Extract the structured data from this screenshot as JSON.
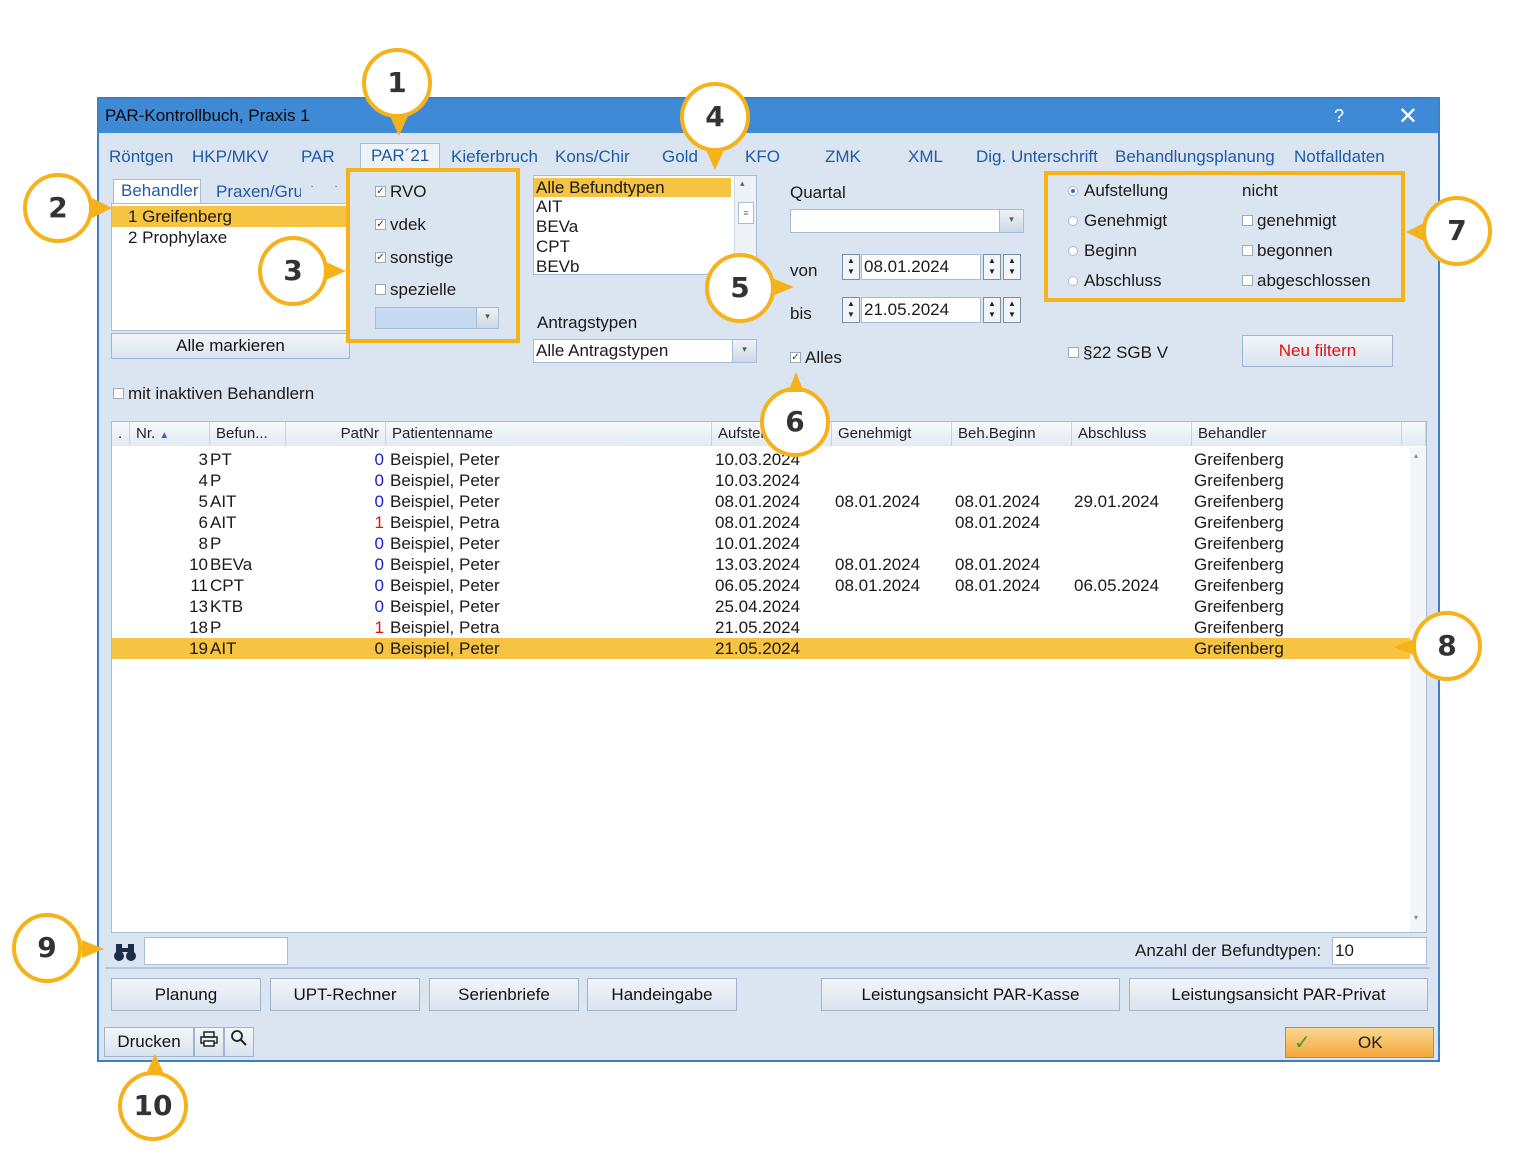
{
  "window": {
    "title": "PAR-Kontrollbuch, Praxis 1",
    "help": "?",
    "close": "✕"
  },
  "tabs": [
    "Röntgen",
    "HKP/MKV",
    "PAR",
    "PAR´21",
    "Kieferbruch",
    "Kons/Chir",
    "Gold",
    "KFO",
    "ZMK",
    "XML",
    "Dig. Unterschrift",
    "Behandlungsplanung",
    "Notfalldaten"
  ],
  "behandler": {
    "tab1": "Behandler",
    "tab2": "Praxen/Gru",
    "items": [
      "1 Greifenberg",
      "2 Prophylaxe"
    ],
    "selected_index": 0,
    "mark_all": "Alle markieren",
    "inactive": "mit inaktiven Behandlern"
  },
  "kassen": [
    {
      "label": "RVO",
      "checked": true
    },
    {
      "label": "vdek",
      "checked": true
    },
    {
      "label": "sonstige",
      "checked": true
    },
    {
      "label": "spezielle",
      "checked": false
    }
  ],
  "befundtypen": {
    "items": [
      "Alle Befundtypen",
      "AIT",
      "BEVa",
      "CPT",
      "BEVb"
    ],
    "selected_index": 0
  },
  "antragstypen": {
    "label": "Antragstypen",
    "value": "Alle Antragstypen"
  },
  "zeitraum": {
    "quartal_label": "Quartal",
    "quartal_value": "",
    "von_label": "von",
    "von_value": "08.01.2024",
    "bis_label": "bis",
    "bis_value": "21.05.2024",
    "alles_label": "Alles",
    "alles_checked": true
  },
  "status": {
    "radios": [
      {
        "label": "Aufstellung",
        "selected": true
      },
      {
        "label": "Genehmigt",
        "selected": false
      },
      {
        "label": "Beginn",
        "selected": false
      },
      {
        "label": "Abschluss",
        "selected": false
      }
    ],
    "nicht_label": "nicht",
    "nicht_checks": [
      "genehmigt",
      "begonnen",
      "abgeschlossen"
    ]
  },
  "sgb": "§22 SGB V",
  "neu_filtern": "Neu filtern",
  "table": {
    "columns": [
      ".",
      "Nr.",
      "Befun...",
      "PatNr",
      "Patientenname",
      "Aufstellung",
      "Genehmigt",
      "Beh.Beginn",
      "Abschluss",
      "Behandler"
    ],
    "rows": [
      {
        "nr": "3",
        "befund": "PT",
        "patnr": "0",
        "name": "Beispiel, Peter",
        "aufst": "10.03.2024",
        "gen": "",
        "beginn": "",
        "abschluss": "",
        "behandler": "Greifenberg"
      },
      {
        "nr": "4",
        "befund": "P",
        "patnr": "0",
        "name": "Beispiel, Peter",
        "aufst": "10.03.2024",
        "gen": "",
        "beginn": "",
        "abschluss": "",
        "behandler": "Greifenberg"
      },
      {
        "nr": "5",
        "befund": "AIT",
        "patnr": "0",
        "name": "Beispiel, Peter",
        "aufst": "08.01.2024",
        "gen": "08.01.2024",
        "beginn": "08.01.2024",
        "abschluss": "29.01.2024",
        "behandler": "Greifenberg"
      },
      {
        "nr": "6",
        "befund": "AIT",
        "patnr": "1",
        "name": "Beispiel, Petra",
        "aufst": "08.01.2024",
        "gen": "",
        "beginn": "08.01.2024",
        "abschluss": "",
        "behandler": "Greifenberg"
      },
      {
        "nr": "8",
        "befund": "P",
        "patnr": "0",
        "name": "Beispiel, Peter",
        "aufst": "10.01.2024",
        "gen": "",
        "beginn": "",
        "abschluss": "",
        "behandler": "Greifenberg"
      },
      {
        "nr": "10",
        "befund": "BEVa",
        "patnr": "0",
        "name": "Beispiel, Peter",
        "aufst": "13.03.2024",
        "gen": "08.01.2024",
        "beginn": "08.01.2024",
        "abschluss": "",
        "behandler": "Greifenberg"
      },
      {
        "nr": "11",
        "befund": "CPT",
        "patnr": "0",
        "name": "Beispiel, Peter",
        "aufst": "06.05.2024",
        "gen": "08.01.2024",
        "beginn": "08.01.2024",
        "abschluss": "06.05.2024",
        "behandler": "Greifenberg"
      },
      {
        "nr": "13",
        "befund": "KTB",
        "patnr": "0",
        "name": "Beispiel, Peter",
        "aufst": "25.04.2024",
        "gen": "",
        "beginn": "",
        "abschluss": "",
        "behandler": "Greifenberg"
      },
      {
        "nr": "18",
        "befund": "P",
        "patnr": "1",
        "name": "Beispiel, Petra",
        "aufst": "21.05.2024",
        "gen": "",
        "beginn": "",
        "abschluss": "",
        "behandler": "Greifenberg"
      },
      {
        "nr": "19",
        "befund": "AIT",
        "patnr": "0",
        "name": "Beispiel, Peter",
        "aufst": "21.05.2024",
        "gen": "",
        "beginn": "",
        "abschluss": "",
        "behandler": "Greifenberg"
      }
    ],
    "selected_index": 9
  },
  "search": {
    "value": ""
  },
  "count": {
    "label": "Anzahl der Befundtypen:",
    "value": "10"
  },
  "buttons": {
    "planung": "Planung",
    "upt": "UPT-Rechner",
    "serienbriefe": "Serienbriefe",
    "handeingabe": "Handeingabe",
    "kasse": "Leistungsansicht PAR-Kasse",
    "privat": "Leistungsansicht PAR-Privat",
    "drucken": "Drucken",
    "ok": "OK"
  },
  "callouts": [
    "1",
    "2",
    "3",
    "4",
    "5",
    "6",
    "7",
    "8",
    "9",
    "10"
  ],
  "colors": {
    "accent": "#f5b21a",
    "selection": "#f6c342",
    "titlebar": "#3f8ad6",
    "patnr_blue": "#1a1ad0",
    "patnr_red": "#e01010"
  }
}
